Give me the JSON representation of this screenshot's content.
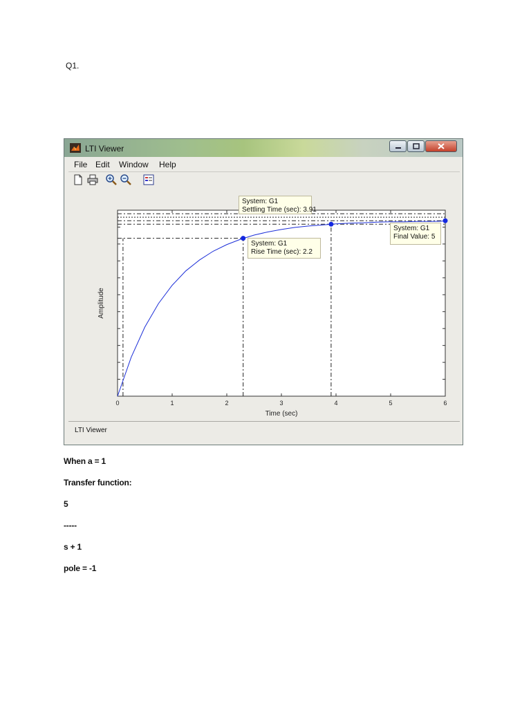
{
  "doc": {
    "heading": "Q1.",
    "when": "When a = 1",
    "tf_label": "Transfer function:",
    "numerator": " 5",
    "divider": "-----",
    "denominator": "s + 1",
    "pole": "pole = -1"
  },
  "window": {
    "title": "LTI Viewer",
    "menu": [
      "File",
      "Edit",
      "Window",
      "Help"
    ],
    "status": "LTI Viewer",
    "icons": [
      "new-file-icon",
      "print-icon",
      "zoom-in-icon",
      "zoom-out-icon",
      "grid-legend-icon"
    ]
  },
  "chart_data": {
    "type": "line",
    "xlabel": "Time (sec)",
    "ylabel": "Amplitude",
    "xlim": [
      0,
      6
    ],
    "ylim": [
      0,
      5.3
    ],
    "xticks": [
      0,
      1,
      2,
      3,
      4,
      5,
      6
    ],
    "series": [
      {
        "x": [
          0,
          0.25,
          0.5,
          0.75,
          1,
          1.25,
          1.5,
          1.75,
          2,
          2.25,
          2.5,
          2.75,
          3,
          3.25,
          3.5,
          3.75,
          4,
          4.25,
          4.5,
          4.75,
          5,
          5.25,
          5.5,
          5.75,
          6
        ],
        "y": [
          0,
          1.11,
          1.97,
          2.64,
          3.16,
          3.57,
          3.88,
          4.13,
          4.32,
          4.47,
          4.59,
          4.68,
          4.75,
          4.81,
          4.85,
          4.88,
          4.91,
          4.93,
          4.94,
          4.96,
          4.97,
          4.97,
          4.98,
          4.98,
          4.99
        ]
      }
    ],
    "markers": [
      {
        "x": 2.3,
        "y": 4.5
      },
      {
        "x": 3.91,
        "y": 4.9
      },
      {
        "x": 6,
        "y": 5
      }
    ],
    "annotations": [
      {
        "line1": "System: G1",
        "line2": "Settling Time (sec): 3.91"
      },
      {
        "line1": "System: G1",
        "line2": "Rise Time (sec): 2.2"
      },
      {
        "line1": "System: G1",
        "line2": "Final Value: 5"
      }
    ],
    "reference_lines": {
      "rise_start_x": 0.1,
      "rise_end_x": 2.3,
      "settle_x": 3.91,
      "y_levels": [
        4.5,
        4.9,
        5.0,
        5.1,
        5.2
      ]
    }
  }
}
